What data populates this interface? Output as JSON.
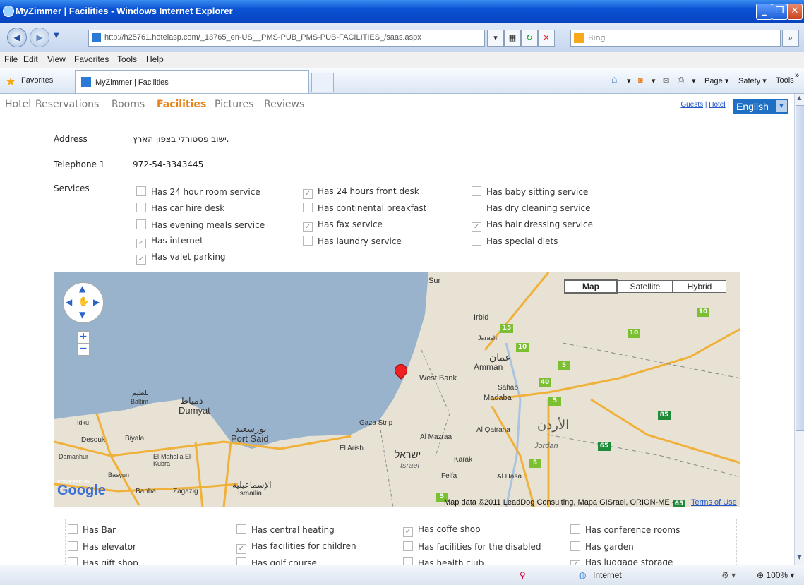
{
  "window": {
    "title": "MyZimmer | Facilities - Windows Internet Explorer",
    "url": "http://h25761.hotelasp.com/_13765_en-US__PMS-PUB_PMS-PUB-FACILITIES_/saas.aspx",
    "search_placeholder": "Bing"
  },
  "menu": [
    "File",
    "Edit",
    "View",
    "Favorites",
    "Tools",
    "Help"
  ],
  "favbar": {
    "favorites_label": "Favorites",
    "tab_title": "MyZimmer | Facilities",
    "page": "Page",
    "safety": "Safety",
    "tools": "Tools"
  },
  "site_nav": {
    "tabs": [
      "Hotel",
      "Reservations",
      "Rooms",
      "Facilities",
      "Pictures",
      "Reviews"
    ],
    "active": "Facilities",
    "guests_link": "Guests",
    "hotel_link": "Hotel",
    "separator": "|",
    "language": "English"
  },
  "details": {
    "address_label": "Address",
    "address_value": "ישוב פסטורלי בצפון הארץ.",
    "telephone_label": "Telephone 1",
    "telephone_value": "972-54-3343445",
    "services_label": "Services"
  },
  "services": [
    {
      "label": "Has 24 hour room service",
      "checked": false
    },
    {
      "label": "Has 24 hours front desk",
      "checked": true
    },
    {
      "label": "Has baby sitting service",
      "checked": false
    },
    {
      "label": "Has car hire desk",
      "checked": false
    },
    {
      "label": "Has continental breakfast",
      "checked": false
    },
    {
      "label": "Has dry cleaning service",
      "checked": false
    },
    {
      "label": "Has evening meals service",
      "checked": false
    },
    {
      "label": "Has fax service",
      "checked": true
    },
    {
      "label": "Has hair dressing service",
      "checked": true
    },
    {
      "label": "Has internet",
      "checked": true
    },
    {
      "label": "Has laundry service",
      "checked": false
    },
    {
      "label": "Has special diets",
      "checked": false
    },
    {
      "label": "Has valet parking",
      "checked": true
    }
  ],
  "map": {
    "types": [
      "Map",
      "Satellite",
      "Hybrid"
    ],
    "active_type": "Map",
    "labels": [
      "Sur",
      "Irbid",
      "Jarash",
      "عمان",
      "Amman",
      "West Bank",
      "Sahab",
      "Madaba",
      "Gaza Strip",
      "Port Said",
      "بورسعيد",
      "Dumyat",
      "دمياط",
      "Baltim",
      "بلطيم",
      "Desouk",
      "Biyala",
      "El-Mahalla El-Kubra",
      "Damanhur",
      "Basyun",
      "Banha",
      "Zagazig",
      "Ismailia",
      "الإسماعيلية",
      "El Arish",
      "Al Mazraa",
      "Karak",
      "ישראל",
      "Israel",
      "Feifa",
      "Al Hasa",
      "Al Qatrana",
      "الأردن",
      "Jordan",
      "Idku"
    ],
    "powered_by": "POWERED BY",
    "logo": "Google",
    "copyright": "Map data ©2011 LeadDog Consulting, Mapa GISrael, ORION-ME -",
    "terms": "Terms of Use",
    "shields": [
      "10",
      "10",
      "15",
      "10",
      "5",
      "40",
      "5",
      "5",
      "85",
      "65",
      "5",
      "65"
    ]
  },
  "facilities": [
    {
      "label": "Has Bar",
      "checked": false
    },
    {
      "label": "Has central heating",
      "checked": false
    },
    {
      "label": "Has coffe shop",
      "checked": true
    },
    {
      "label": "Has conference rooms",
      "checked": false
    },
    {
      "label": "Has elevator",
      "checked": false
    },
    {
      "label": "Has facilities for children",
      "checked": true
    },
    {
      "label": "Has facilities for the disabled",
      "checked": false
    },
    {
      "label": "Has garden",
      "checked": false
    },
    {
      "label": "Has gift shop",
      "checked": false
    },
    {
      "label": "Has golf course",
      "checked": false
    },
    {
      "label": "Has health club",
      "checked": false
    },
    {
      "label": "Has luggage storage",
      "checked": true
    }
  ],
  "status": {
    "zone": "Internet",
    "zoom": "100%"
  }
}
